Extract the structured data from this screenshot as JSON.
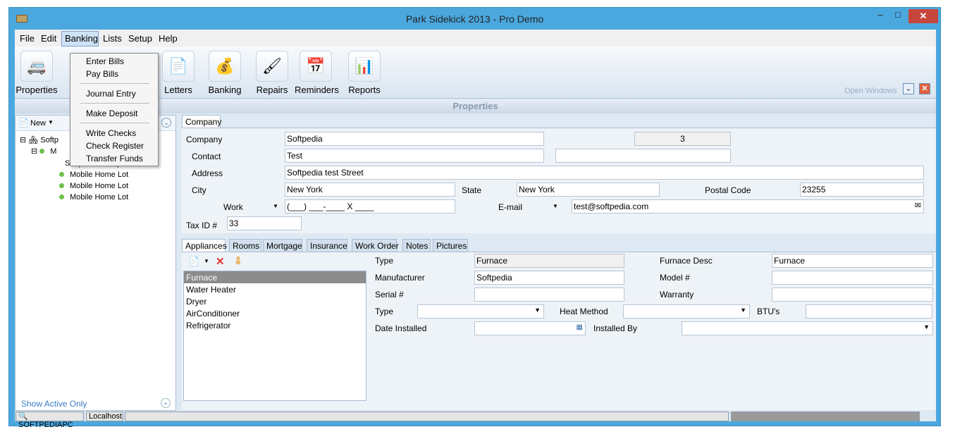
{
  "window": {
    "title": "Park Sidekick 2013 - Pro Demo",
    "min": "–",
    "max": "□",
    "close": "✕"
  },
  "menu": {
    "items": [
      "File",
      "Edit",
      "Banking",
      "Lists",
      "Setup",
      "Help"
    ]
  },
  "banking_menu": {
    "items": [
      "Enter Bills",
      "Pay Bills",
      "Journal Entry",
      "Make Deposit",
      "Write Checks",
      "Check Register",
      "Transfer Funds"
    ]
  },
  "ribbon": {
    "buttons": [
      {
        "label": "Properties",
        "icon": "camper-icon"
      },
      {
        "label": "Letters",
        "icon": "letters-icon"
      },
      {
        "label": "Banking",
        "icon": "money-bag-icon"
      },
      {
        "label": "Repairs",
        "icon": "paint-roller-icon"
      },
      {
        "label": "Reminders",
        "icon": "calendar-icon"
      },
      {
        "label": "Reports",
        "icon": "reports-icon"
      }
    ],
    "open_windows": "Open Windows"
  },
  "section_title": "Properties",
  "left": {
    "new_label": "New",
    "tree": [
      "Softp",
      "M",
      "Softpedia Group",
      "Mobile Home Lot",
      "Mobile Home Lot",
      "Mobile Home Lot"
    ],
    "show_active": "Show Active Only"
  },
  "company_tab": "Company",
  "company": {
    "company_label": "Company",
    "company_value": "Softpedia",
    "id_value": "3",
    "contact_label": "Contact",
    "contact_value": "Test",
    "address_label": "Address",
    "address_value": "Softpedia test Street",
    "city_label": "City",
    "city_value": "New York",
    "state_label": "State",
    "state_value": "New York",
    "postal_label": "Postal Code",
    "postal_value": "23255",
    "work_label": "Work",
    "work_value": "(___) ___-____ X ____",
    "email_label": "E-mail",
    "email_value": "test@softpedia.com",
    "taxid_label": "Tax ID #",
    "taxid_value": "33"
  },
  "subtabs": [
    "Appliances",
    "Rooms",
    "Mortgage",
    "Insurance",
    "Work Order",
    "Notes",
    "Pictures"
  ],
  "appliances": {
    "list": [
      "Furnace",
      "Water Heater",
      "Dryer",
      "AirConditioner",
      "Refrigerator"
    ],
    "type_label": "Type",
    "type_value": "Furnace",
    "desc_label": "Furnace Desc",
    "desc_value": "Furnace",
    "manufacturer_label": "Manufacturer",
    "manufacturer_value": "Softpedia",
    "model_label": "Model #",
    "serial_label": "Serial #",
    "warranty_label": "Warranty",
    "type2_label": "Type",
    "heat_label": "Heat Method",
    "btu_label": "BTU's",
    "date_label": "Date Installed",
    "installed_label": "Installed By"
  },
  "status": {
    "computer": "SOFTPEDIAPC",
    "server": "Localhost"
  }
}
